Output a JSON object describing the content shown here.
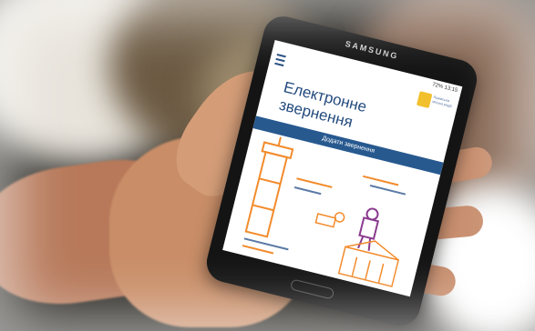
{
  "phone": {
    "brand": "SAMSUNG",
    "status_time": "13:15",
    "status_battery": "72%"
  },
  "app": {
    "title_line1": "Електронне",
    "title_line2": "звернення",
    "logo_text": "Львівська міська рада",
    "cta_label": "Додати звернення"
  },
  "colors": {
    "brand_blue": "#27598f",
    "title_blue": "#234a7e",
    "logo_yellow": "#f2c02c",
    "accent_orange": "#f28b2c"
  },
  "icons": {
    "menu": "hamburger-menu-icon",
    "logo": "city-coat-of-arms-logo"
  }
}
